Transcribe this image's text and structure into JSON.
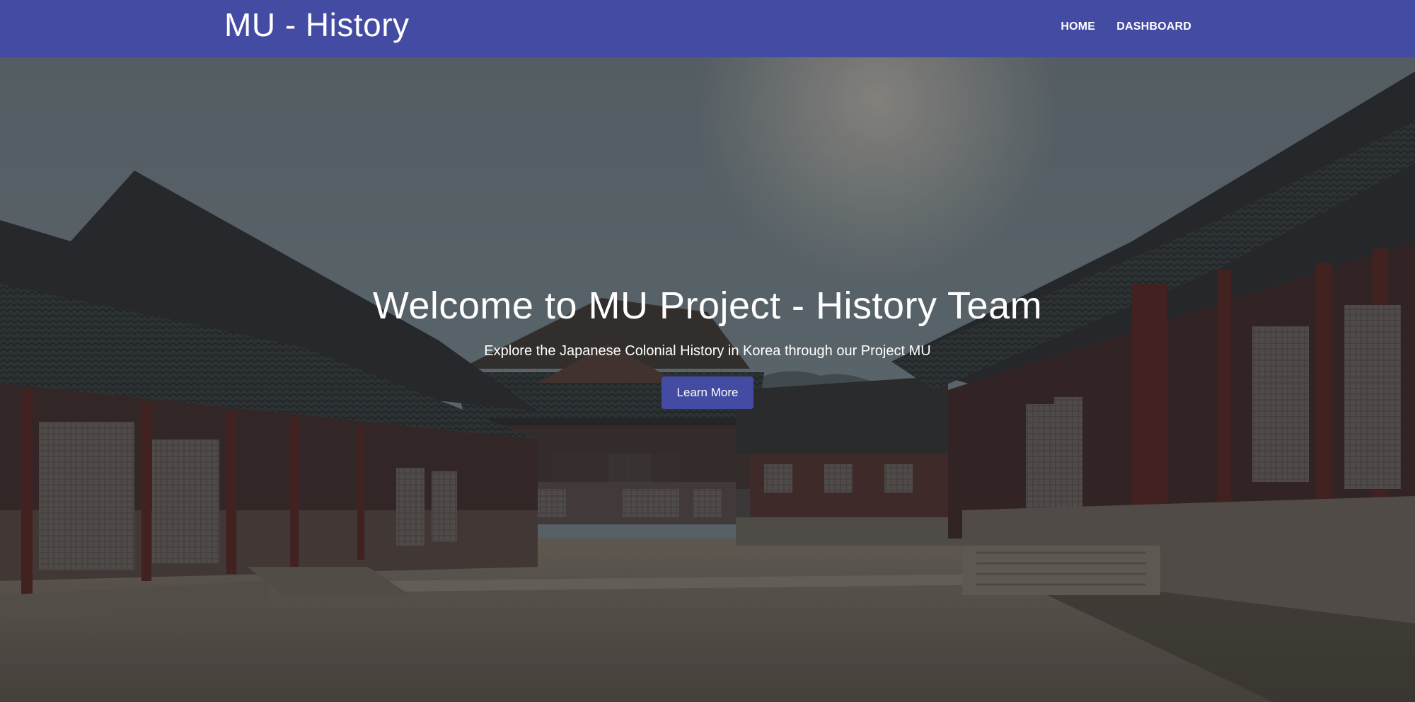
{
  "navbar": {
    "brand": "MU - History",
    "links": [
      {
        "label": "HOME"
      },
      {
        "label": "DASHBOARD"
      }
    ],
    "background": "#434ba2"
  },
  "hero": {
    "title": "Welcome to MU Project - History Team",
    "subtitle": "Explore the Japanese Colonial History in Korea through our Project MU",
    "button_label": "Learn More",
    "background_image": "palace-courtyard-photo"
  }
}
